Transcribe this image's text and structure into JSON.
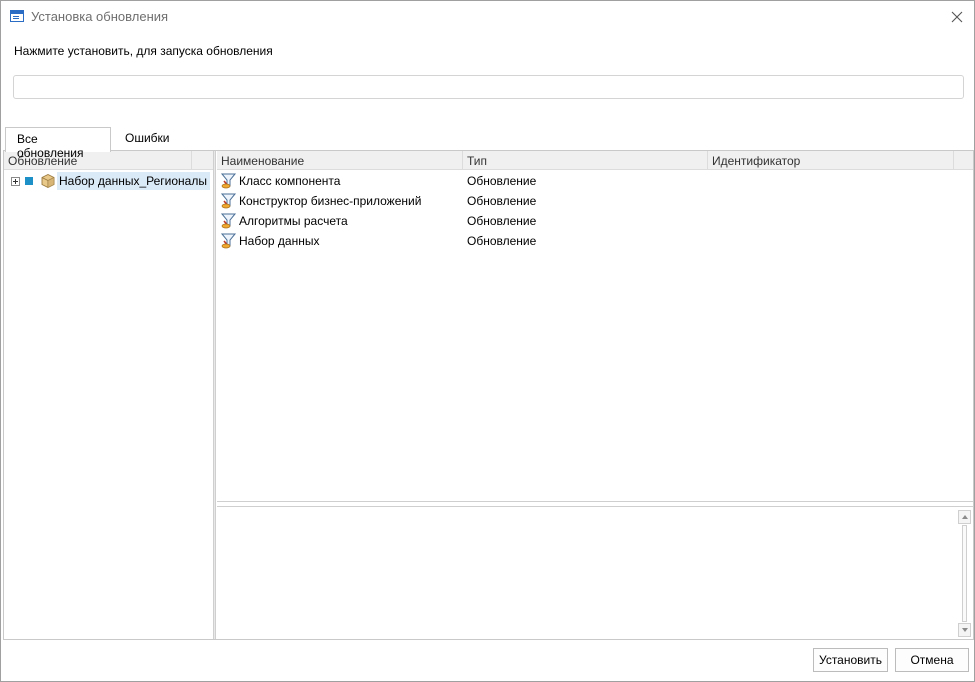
{
  "window": {
    "title": "Установка обновления"
  },
  "instruction": "Нажмите установить, для запуска обновления",
  "progress_text": "",
  "tabs": [
    {
      "label": "Все обновления",
      "active": true
    },
    {
      "label": "Ошибки",
      "active": false
    }
  ],
  "tree": {
    "header": "Обновление",
    "items": [
      {
        "label": "Набор данных_Регионалы",
        "icon": "cube-icon",
        "checked": true,
        "selected": true
      }
    ]
  },
  "grid": {
    "columns": [
      "Наименование",
      "Тип",
      "Идентификатор"
    ],
    "rows": [
      {
        "name": "Класс компонента",
        "type": "Обновление",
        "id": ""
      },
      {
        "name": "Конструктор бизнес-приложений",
        "type": "Обновление",
        "id": ""
      },
      {
        "name": "Алгоритмы расчета",
        "type": "Обновление",
        "id": ""
      },
      {
        "name": "Набор данных",
        "type": "Обновление",
        "id": ""
      }
    ]
  },
  "buttons": {
    "install": "Установить",
    "cancel": "Отмена"
  },
  "colors": {
    "selection": "#dbeaf7",
    "check": "#1e90c8",
    "accent": "#2b6cc4"
  }
}
